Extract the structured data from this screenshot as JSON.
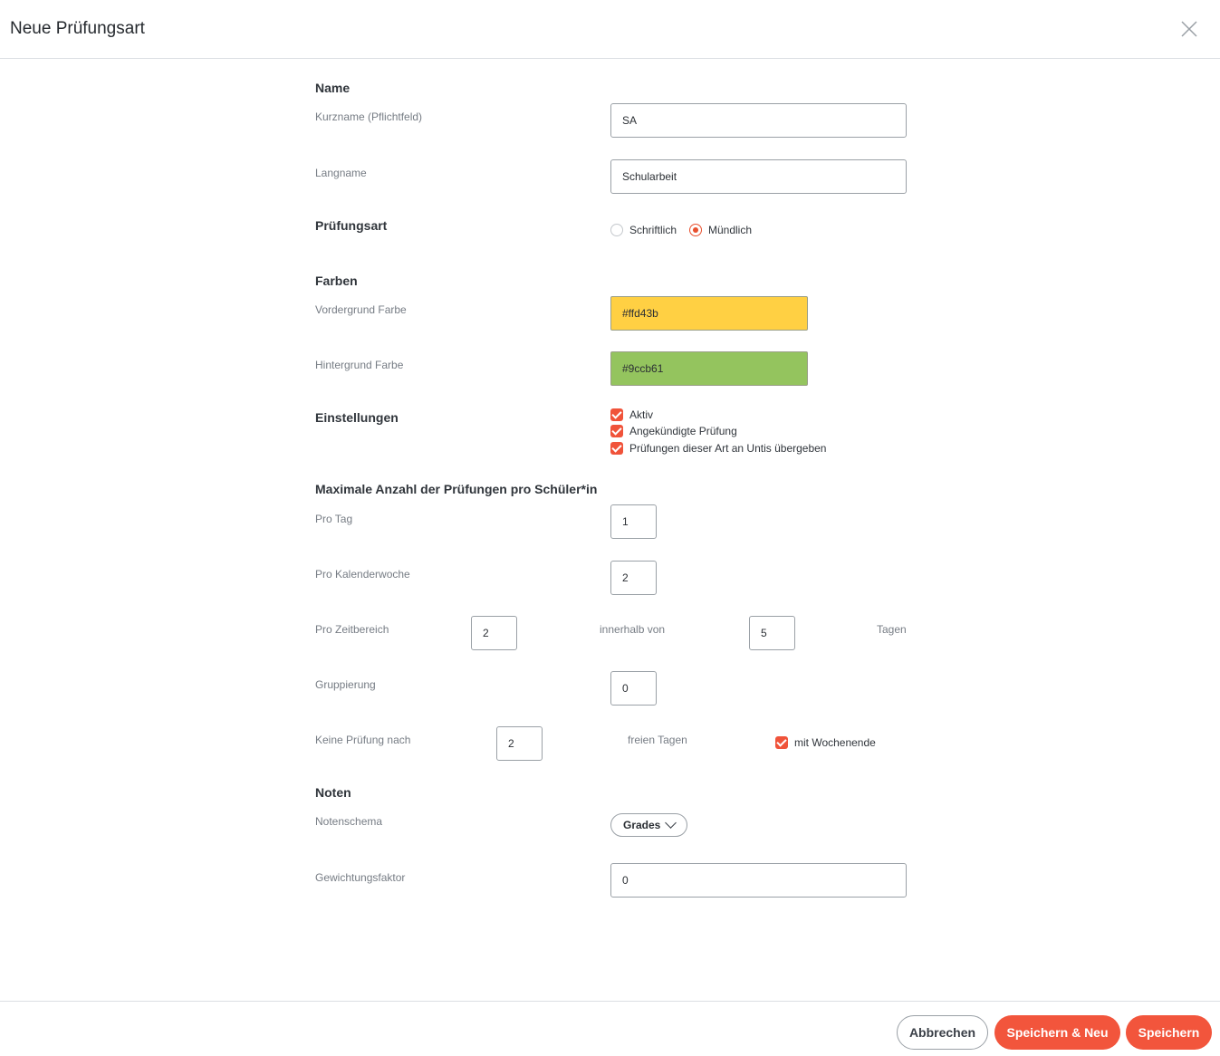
{
  "dialog": {
    "title": "Neue Prüfungsart"
  },
  "name_section": {
    "title": "Name",
    "short_name_label": "Kurzname (Pflichtfeld)",
    "short_name_value": "SA",
    "long_name_label": "Langname",
    "long_name_value": "Schularbeit"
  },
  "exam_type": {
    "title": "Prüfungsart",
    "options": [
      "Schriftlich",
      "Mündlich"
    ],
    "selected": "Mündlich"
  },
  "colors": {
    "title": "Farben",
    "foreground_label": "Vordergrund Farbe",
    "foreground_value": "#ffd43b",
    "background_label": "Hintergrund Farbe",
    "background_value": "#9ccb61"
  },
  "settings": {
    "title": "Einstellungen",
    "items": [
      {
        "label": "Aktiv",
        "checked": true
      },
      {
        "label": "Angekündigte Prüfung",
        "checked": true
      },
      {
        "label": "Prüfungen dieser Art an Untis übergeben",
        "checked": true
      }
    ]
  },
  "max_exams": {
    "title": "Maximale Anzahl der Prüfungen pro Schüler*in",
    "per_day_label": "Pro Tag",
    "per_day_value": "1",
    "per_week_label": "Pro Kalenderwoche",
    "per_week_value": "2",
    "per_range_label": "Pro Zeitbereich",
    "per_range_value": "2",
    "within_label": "innerhalb von",
    "within_value": "5",
    "days_label": "Tagen",
    "grouping_label": "Gruppierung",
    "grouping_value": "0",
    "no_exam_after_label": "Keine Prüfung nach",
    "no_exam_after_value": "2",
    "free_days_label": "freien Tagen",
    "with_weekend_label": "mit Wochenende",
    "with_weekend_checked": true
  },
  "grades": {
    "title": "Noten",
    "scheme_label": "Notenschema",
    "scheme_value": "Grades",
    "weight_label": "Gewichtungsfaktor",
    "weight_value": "0"
  },
  "footer": {
    "cancel_label": "Abbrechen",
    "save_new_label": "Speichern & Neu",
    "save_label": "Speichern"
  },
  "accent_color": "#f2553c"
}
